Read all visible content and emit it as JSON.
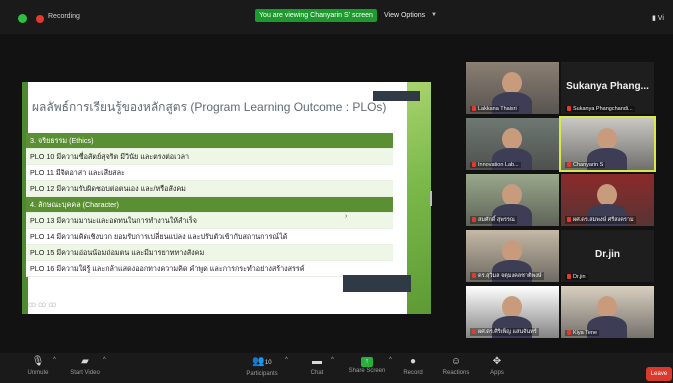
{
  "topbar": {
    "recording": "Recording",
    "viewing_banner": "You are viewing Chanyarin S' screen",
    "view_options": "View Options",
    "view_right": "Vi"
  },
  "slide": {
    "title": "ผลลัพธ์การเรียนรู้ของหลักสูตร (Program Learning Outcome : PLOs)",
    "rows": [
      {
        "text": "3. จริยธรรม (Ethics)",
        "type": "hdr"
      },
      {
        "text": "PLO 10  มีความซื่อสัตย์สุจริต มีวินัย และตรงต่อเวลา",
        "type": "odd"
      },
      {
        "text": "PLO 11  มีจิตอาสา และเสียสละ",
        "type": "even"
      },
      {
        "text": "PLO 12  มีความรับผิดชอบต่อตนเอง และ/หรือสังคม",
        "type": "odd"
      },
      {
        "text": "4. ลักษณะบุคคล (Character)",
        "type": "hdr"
      },
      {
        "text": "PLO 13  มีความมานะและอดทนในการทำงานให้สำเร็จ",
        "type": "odd"
      },
      {
        "text": "PLO 14  มีความคิดเชิงบวก ยอมรับการเปลี่ยนแปลง และปรับตัวเข้ากับสถานการณ์ได้",
        "type": "even"
      },
      {
        "text": "PLO 15  มีความอ่อนน้อมถ่อมตน และมีมารยาททางสังคม",
        "type": "odd"
      },
      {
        "text": "PLO 16  มีความใฝ่รู้ และกล้าแสดงออกทางความคิด คำพูด และการกระทำอย่างสร้างสรรค์",
        "type": "even"
      }
    ],
    "footer": "ꝏꝏꝏ"
  },
  "participants": [
    {
      "name": "Lakkana Thaisri",
      "type": "video",
      "bg": "#8a7f73"
    },
    {
      "name": "Sukanya Phangchandi...",
      "big": "Sukanya Phang...",
      "type": "name"
    },
    {
      "name": "Innovation Lab...",
      "type": "video",
      "bg": "#6f7872"
    },
    {
      "name": "Chanyarin S",
      "type": "video",
      "bg": "#c9c8c3",
      "active": true
    },
    {
      "name": "สมศักดิ์ สุพรรณ",
      "type": "video",
      "bg": "#9aa88c"
    },
    {
      "name": "ผศ.ดร.สมพงษ์ ศรีสงคราม",
      "type": "video",
      "bg": "#8b2a2a"
    },
    {
      "name": "ดร.สุวิมล จตุมงคลชาติพงษ์",
      "type": "video",
      "bg": "#c5b9a6"
    },
    {
      "name": "Dr.jin",
      "big": "Dr.jin",
      "type": "name"
    },
    {
      "name": "ผศ.ดร.ศิริเพ็ญ แสนจันทร์",
      "type": "video",
      "bg": "#ffffff"
    },
    {
      "name": "Kiya Tene",
      "type": "video",
      "bg": "#d8cfc0"
    }
  ],
  "toolbar": {
    "unmute": "Unmute",
    "start_video": "Start Video",
    "participants": "Participants",
    "participants_count": "10",
    "chat": "Chat",
    "share_screen": "Share Screen",
    "record": "Record",
    "reactions": "Reactions",
    "apps": "Apps",
    "leave": "Leave"
  }
}
